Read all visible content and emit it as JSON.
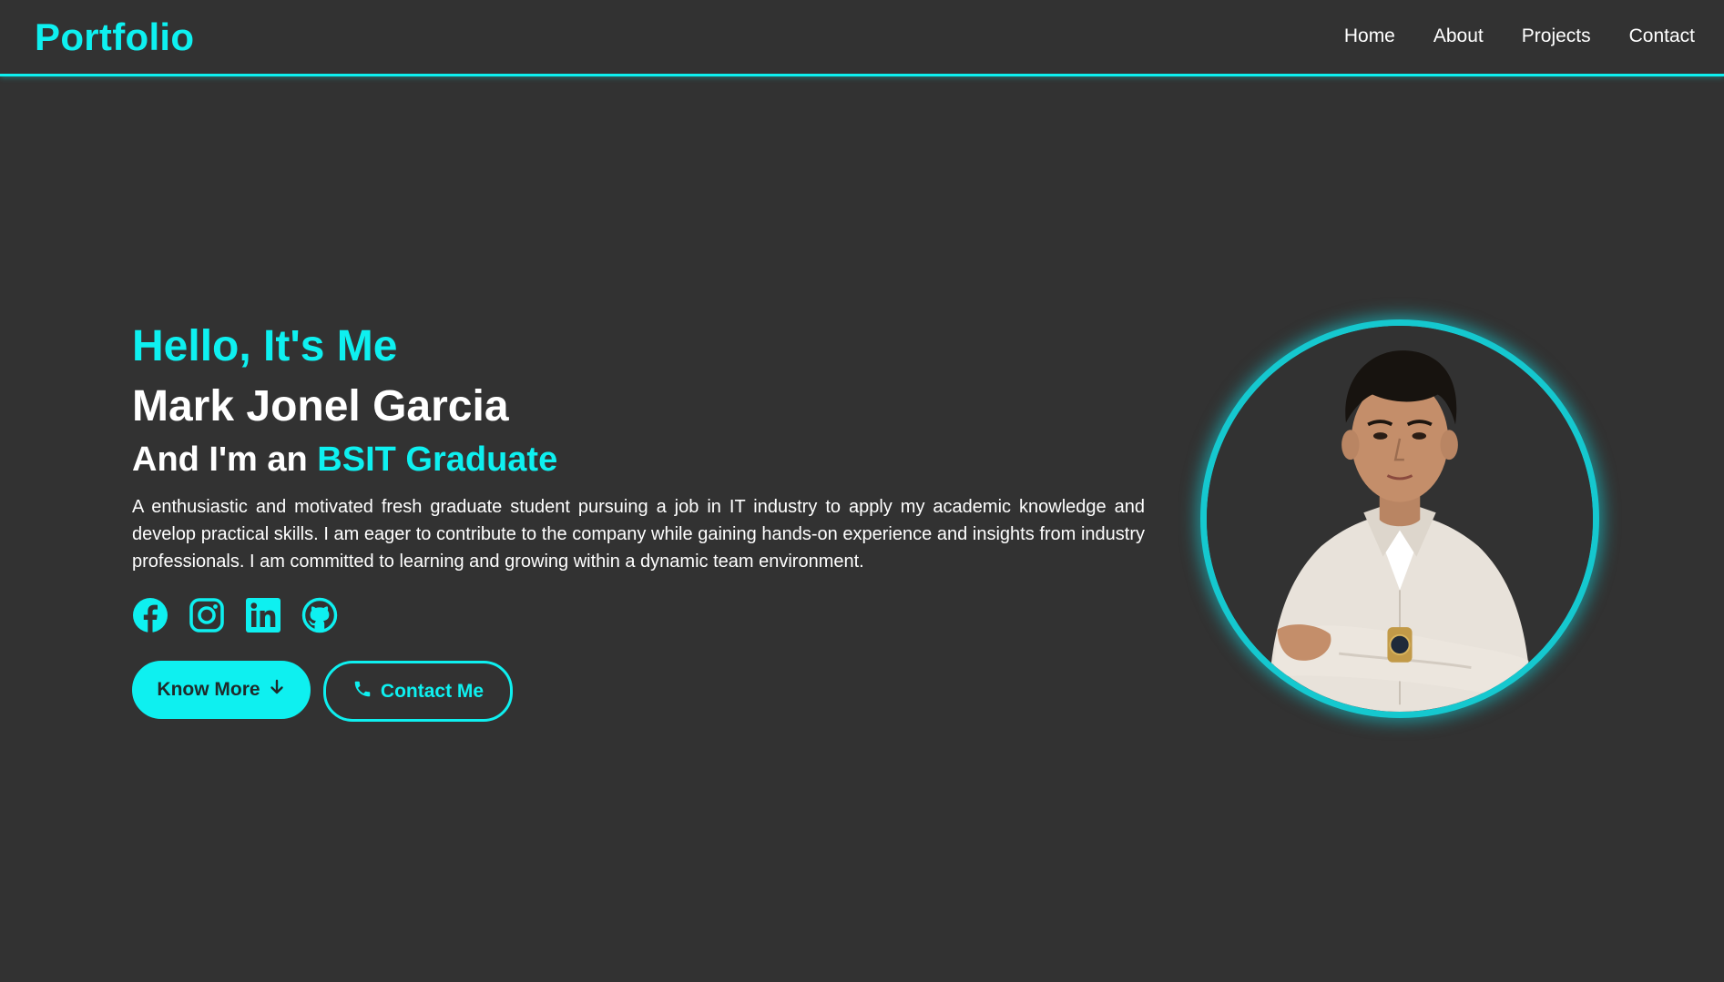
{
  "header": {
    "logo": "Portfolio",
    "nav": [
      "Home",
      "About",
      "Projects",
      "Contact"
    ]
  },
  "hero": {
    "greeting": "Hello, It's Me",
    "name": "Mark Jonel Garcia",
    "role_prefix": "And I'm an",
    "role_highlight": "BSIT Graduate",
    "bio": "A enthusiastic and motivated fresh graduate student pursuing a job in IT industry to apply my academic knowledge and develop practical skills. I am eager to contribute to the company while gaining hands-on experience and insights from industry professionals. I am committed to learning and growing within a dynamic team environment.",
    "socials": [
      "facebook-icon",
      "instagram-icon",
      "linkedin-icon",
      "github-icon"
    ],
    "buttons": {
      "know_more": "Know More",
      "contact": "Contact Me"
    }
  },
  "colors": {
    "accent": "#0ef0f0",
    "background": "#323232",
    "text": "#ffffff"
  }
}
